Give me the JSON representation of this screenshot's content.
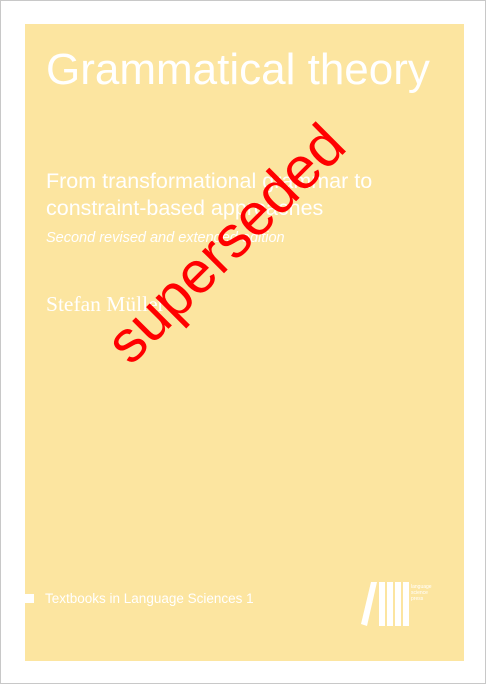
{
  "cover": {
    "title": "Grammatical theory",
    "subtitle": "From transformational grammar to constraint-based approaches",
    "edition": "Second revised and extended edition",
    "author": "Stefan Müller",
    "series": "Textbooks in Language Sciences 1",
    "publisher_logo_lines": [
      "language",
      "science",
      "press"
    ],
    "background_color": "#fce5a0"
  },
  "stamp": {
    "text": "superseded",
    "color": "#ff0000"
  }
}
